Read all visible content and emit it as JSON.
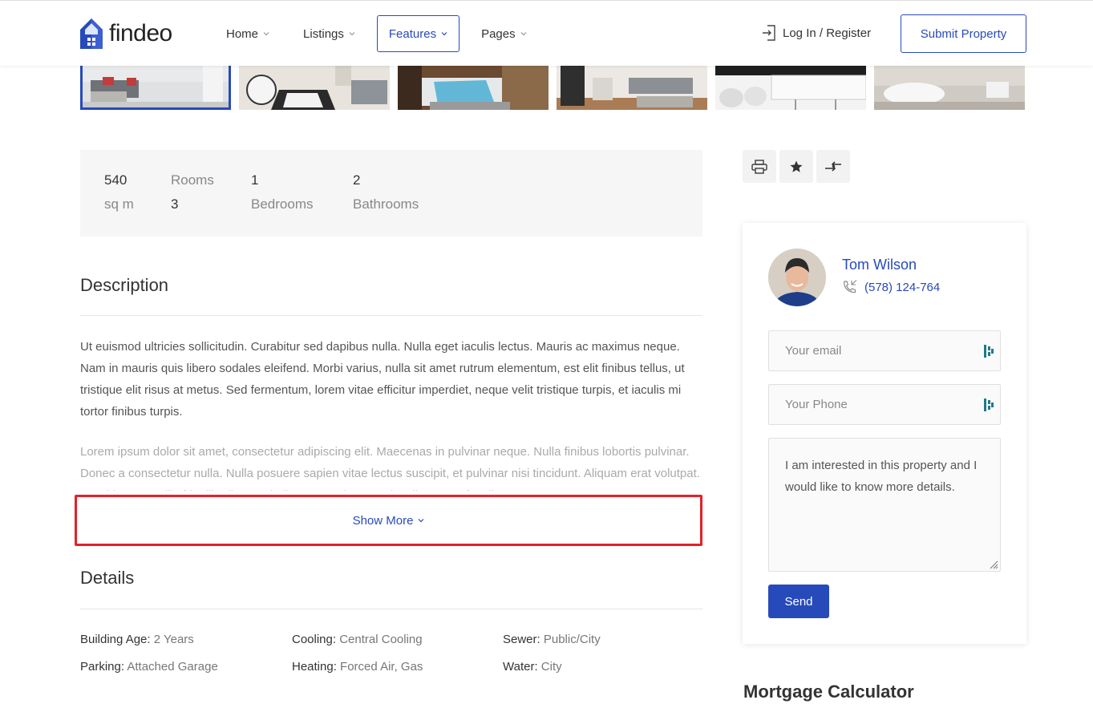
{
  "header": {
    "logo_text": "findeo",
    "nav": [
      {
        "label": "Home",
        "active": false
      },
      {
        "label": "Listings",
        "active": false
      },
      {
        "label": "Features",
        "active": true
      },
      {
        "label": "Pages",
        "active": false
      }
    ],
    "login_label": "Log In / Register",
    "submit_label": "Submit Property",
    "accent_color": "#274abb"
  },
  "gallery": {
    "thumbnails": [
      "living-room",
      "kids-room",
      "bedroom",
      "dining-room",
      "kitchen",
      "bathroom"
    ],
    "selected_index": 0
  },
  "overview": {
    "area_value": "540",
    "area_unit": "sq m",
    "rooms_label": "Rooms",
    "rooms_value": "3",
    "bedrooms_value": "1",
    "bedrooms_label": "Bedrooms",
    "bathrooms_value": "2",
    "bathrooms_label": "Bathrooms"
  },
  "actions": [
    "print-icon",
    "star-icon",
    "compare-icon"
  ],
  "description": {
    "title": "Description",
    "paragraph1": "Ut euismod ultricies sollicitudin. Curabitur sed dapibus nulla. Nulla eget iaculis lectus. Mauris ac maximus neque. Nam in mauris quis libero sodales eleifend. Morbi varius, nulla sit amet rutrum elementum, est elit finibus tellus, ut tristique elit risus at metus. Sed fermentum, lorem vitae efficitur imperdiet, neque velit tristique turpis, et iaculis mi tortor finibus turpis.",
    "paragraph2": "Lorem ipsum dolor sit amet, consectetur adipiscing elit. Maecenas in pulvinar neque. Nulla finibus lobortis pulvinar. Donec a consectetur nulla. Nulla posuere sapien vitae lectus suscipit, et pulvinar nisi tincidunt. Aliquam erat volutpat. Curabitur convallis fringilla diam sed aliquam. Sed tempor iaculis massa faucibus.",
    "show_more_label": "Show More"
  },
  "details": {
    "title": "Details",
    "items": [
      {
        "label": "Building Age:",
        "value": "2 Years"
      },
      {
        "label": "Cooling:",
        "value": "Central Cooling"
      },
      {
        "label": "Sewer:",
        "value": "Public/City"
      },
      {
        "label": "Parking:",
        "value": "Attached Garage"
      },
      {
        "label": "Heating:",
        "value": "Forced Air, Gas"
      },
      {
        "label": "Water:",
        "value": "City"
      }
    ]
  },
  "agent": {
    "name": "Tom Wilson",
    "phone": "(578) 124-764",
    "email_placeholder": "Your email",
    "phone_placeholder": "Your Phone",
    "message": "I am interested in this property and I would like to know more details.",
    "send_label": "Send"
  },
  "sidebar": {
    "mortgage_title": "Mortgage Calculator"
  }
}
